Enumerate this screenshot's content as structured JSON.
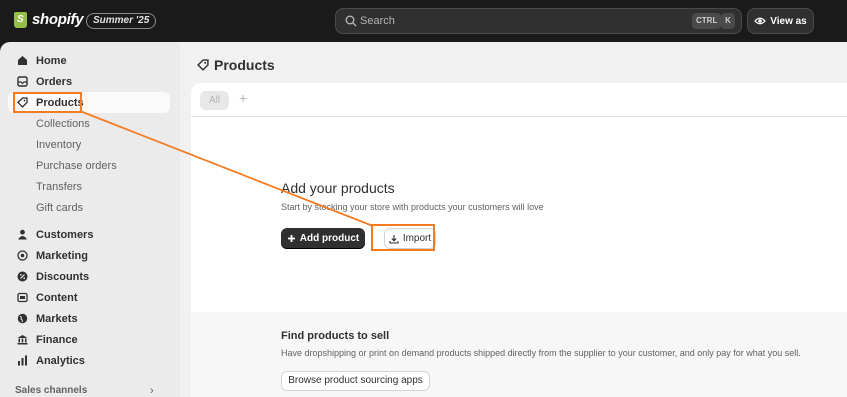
{
  "topbar": {
    "brand": "shopify",
    "edition": "Summer '25",
    "search_placeholder": "Search",
    "shortcut_ctrl": "CTRL",
    "shortcut_k": "K",
    "view_as": "View as"
  },
  "sidebar": {
    "items": [
      {
        "label": "Home",
        "icon": "home-icon"
      },
      {
        "label": "Orders",
        "icon": "inbox-icon"
      },
      {
        "label": "Products",
        "icon": "tag-icon",
        "active": true
      },
      {
        "label": "Customers",
        "icon": "person-icon"
      },
      {
        "label": "Marketing",
        "icon": "target-icon"
      },
      {
        "label": "Discounts",
        "icon": "discount-icon"
      },
      {
        "label": "Content",
        "icon": "content-icon"
      },
      {
        "label": "Markets",
        "icon": "globe-icon"
      },
      {
        "label": "Finance",
        "icon": "bank-icon"
      },
      {
        "label": "Analytics",
        "icon": "chart-icon"
      }
    ],
    "product_subitems": [
      "Collections",
      "Inventory",
      "Purchase orders",
      "Transfers",
      "Gift cards"
    ],
    "sales_channels": "Sales channels"
  },
  "main": {
    "title": "Products",
    "tab_all": "All",
    "tab_add": "+",
    "empty_title": "Add your products",
    "empty_desc": "Start by stocking your store with products your customers will love",
    "add_product": "Add product",
    "import": "Import",
    "sourcing_title": "Find products to sell",
    "sourcing_desc": "Have dropshipping or print on demand products shipped directly from the supplier to your customer, and only pay for what you sell.",
    "browse": "Browse product sourcing apps"
  },
  "colors": {
    "highlight": "#f47b20",
    "topbar": "#1a1a1a",
    "brand_green": "#95bf47"
  }
}
